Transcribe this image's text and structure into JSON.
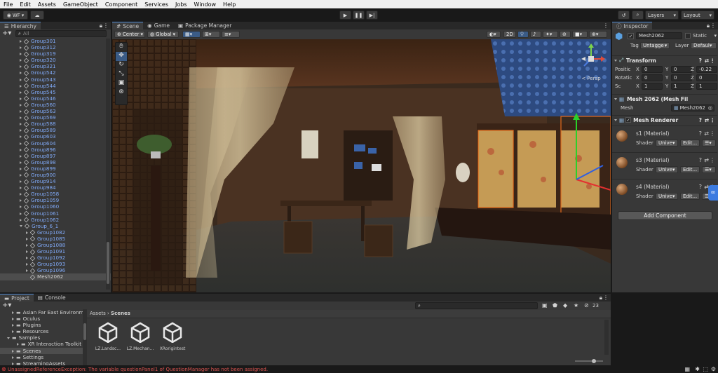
{
  "menu": [
    "File",
    "Edit",
    "Assets",
    "GameObject",
    "Component",
    "Services",
    "Jobs",
    "Window",
    "Help"
  ],
  "toolbar": {
    "account": "WF",
    "layers": "Layers",
    "layout": "Layout"
  },
  "hierarchy": {
    "title": "Hierarchy",
    "search_placeholder": "All",
    "items": [
      {
        "label": "Group301",
        "indent": 1,
        "blue": true,
        "arrow": "right"
      },
      {
        "label": "Group312",
        "indent": 1,
        "blue": true,
        "arrow": "right"
      },
      {
        "label": "Group319",
        "indent": 1,
        "blue": true,
        "arrow": "right"
      },
      {
        "label": "Group320",
        "indent": 1,
        "blue": true,
        "arrow": "right"
      },
      {
        "label": "Group321",
        "indent": 1,
        "blue": true,
        "arrow": "right"
      },
      {
        "label": "Group542",
        "indent": 1,
        "blue": true,
        "arrow": "right"
      },
      {
        "label": "Group543",
        "indent": 1,
        "blue": true,
        "arrow": "right"
      },
      {
        "label": "Group544",
        "indent": 1,
        "blue": true,
        "arrow": "right"
      },
      {
        "label": "Group545",
        "indent": 1,
        "blue": true,
        "arrow": "right"
      },
      {
        "label": "Group546",
        "indent": 1,
        "blue": true,
        "arrow": "right"
      },
      {
        "label": "Group560",
        "indent": 1,
        "blue": true,
        "arrow": "right"
      },
      {
        "label": "Group563",
        "indent": 1,
        "blue": true,
        "arrow": "right"
      },
      {
        "label": "Group569",
        "indent": 1,
        "blue": true,
        "arrow": "right"
      },
      {
        "label": "Group588",
        "indent": 1,
        "blue": true,
        "arrow": "right"
      },
      {
        "label": "Group589",
        "indent": 1,
        "blue": true,
        "arrow": "right"
      },
      {
        "label": "Group603",
        "indent": 1,
        "blue": true,
        "arrow": "right"
      },
      {
        "label": "Group604",
        "indent": 1,
        "blue": true,
        "arrow": "right"
      },
      {
        "label": "Group896",
        "indent": 1,
        "blue": true,
        "arrow": "right"
      },
      {
        "label": "Group897",
        "indent": 1,
        "blue": true,
        "arrow": "right"
      },
      {
        "label": "Group898",
        "indent": 1,
        "blue": true,
        "arrow": "right"
      },
      {
        "label": "Group899",
        "indent": 1,
        "blue": true,
        "arrow": "right"
      },
      {
        "label": "Group900",
        "indent": 1,
        "blue": true,
        "arrow": "right"
      },
      {
        "label": "Group914",
        "indent": 1,
        "blue": true,
        "arrow": "right"
      },
      {
        "label": "Group984",
        "indent": 1,
        "blue": true,
        "arrow": "right"
      },
      {
        "label": "Group1058",
        "indent": 1,
        "blue": true,
        "arrow": "right"
      },
      {
        "label": "Group1059",
        "indent": 1,
        "blue": true,
        "arrow": "right"
      },
      {
        "label": "Group1060",
        "indent": 1,
        "blue": true,
        "arrow": "right"
      },
      {
        "label": "Group1061",
        "indent": 1,
        "blue": true,
        "arrow": "right"
      },
      {
        "label": "Group1062",
        "indent": 1,
        "blue": true,
        "arrow": "right"
      },
      {
        "label": "Group_6_1",
        "indent": 1,
        "blue": true,
        "arrow": "down"
      },
      {
        "label": "Group1082",
        "indent": 2,
        "blue": true,
        "arrow": "right"
      },
      {
        "label": "Group1085",
        "indent": 2,
        "blue": true,
        "arrow": "right"
      },
      {
        "label": "Group1088",
        "indent": 2,
        "blue": true,
        "arrow": "right"
      },
      {
        "label": "Group1091",
        "indent": 2,
        "blue": true,
        "arrow": "right"
      },
      {
        "label": "Group1092",
        "indent": 2,
        "blue": true,
        "arrow": "right"
      },
      {
        "label": "Group1093",
        "indent": 2,
        "blue": true,
        "arrow": "right"
      },
      {
        "label": "Group1096",
        "indent": 2,
        "blue": true,
        "arrow": "right"
      },
      {
        "label": "Mesh2062",
        "indent": 2,
        "blue": false,
        "arrow": "none",
        "selected": true
      }
    ]
  },
  "scene": {
    "tabs": [
      "Scene",
      "Game",
      "Package Manager"
    ],
    "pivot": "Center",
    "space": "Global",
    "mode_2d": "2D",
    "gizmo_label": "< Persp"
  },
  "inspector": {
    "title": "Inspector",
    "object_name": "Mesh2062",
    "static_label": "Static",
    "tag_label": "Tag",
    "tag_value": "Untagge",
    "layer_label": "Layer",
    "layer_value": "Defaul",
    "transform": {
      "title": "Transform",
      "rows": [
        {
          "label": "Positic",
          "x": "0",
          "y": "0",
          "z": "-0.22"
        },
        {
          "label": "Rotatic",
          "x": "0",
          "y": "0",
          "z": "0"
        },
        {
          "label": "Sc",
          "x": "1",
          "y": "1",
          "z": "1"
        }
      ]
    },
    "mesh_filter": {
      "title": "Mesh 2062 (Mesh Fil",
      "mesh_label": "Mesh",
      "mesh_value": "Mesh2062"
    },
    "mesh_renderer": {
      "title": "Mesh Renderer"
    },
    "materials": [
      {
        "name": "s1 (Material)",
        "shader_label": "Shader",
        "shader_value": "Unive",
        "edit": "Edit..."
      },
      {
        "name": "s3 (Material)",
        "shader_label": "Shader",
        "shader_value": "Unive",
        "edit": "Edit..."
      },
      {
        "name": "s4 (Material)",
        "shader_label": "Shader",
        "shader_value": "Unive",
        "edit": "Edit..."
      }
    ],
    "add_component": "Add Component"
  },
  "project": {
    "tabs": [
      "Project",
      "Console"
    ],
    "tree": [
      {
        "label": "Asian Far East Environme",
        "indent": 1
      },
      {
        "label": "Oculus",
        "indent": 1
      },
      {
        "label": "Plugins",
        "indent": 1
      },
      {
        "label": "Resources",
        "indent": 1
      },
      {
        "label": "Samples",
        "indent": 0
      },
      {
        "label": "XR Interaction Toolkit",
        "indent": 2
      },
      {
        "label": "Scenes",
        "indent": 1,
        "selected": true
      },
      {
        "label": "Settings",
        "indent": 1
      },
      {
        "label": "StreamingAssets",
        "indent": 1
      }
    ],
    "breadcrumb": [
      "Assets",
      "Scenes"
    ],
    "assets": [
      "LZ.Landsc...",
      "LZ.Mechan...",
      "XRorigintest"
    ],
    "hidden_count": "23"
  },
  "status": {
    "error": "UnassignedReferenceException: The variable questionPanel1 of QuestionManager has not been assigned."
  },
  "colors": {
    "accent": "#4f8cd8",
    "selection": "#2c5d87",
    "error": "#d9534f"
  }
}
